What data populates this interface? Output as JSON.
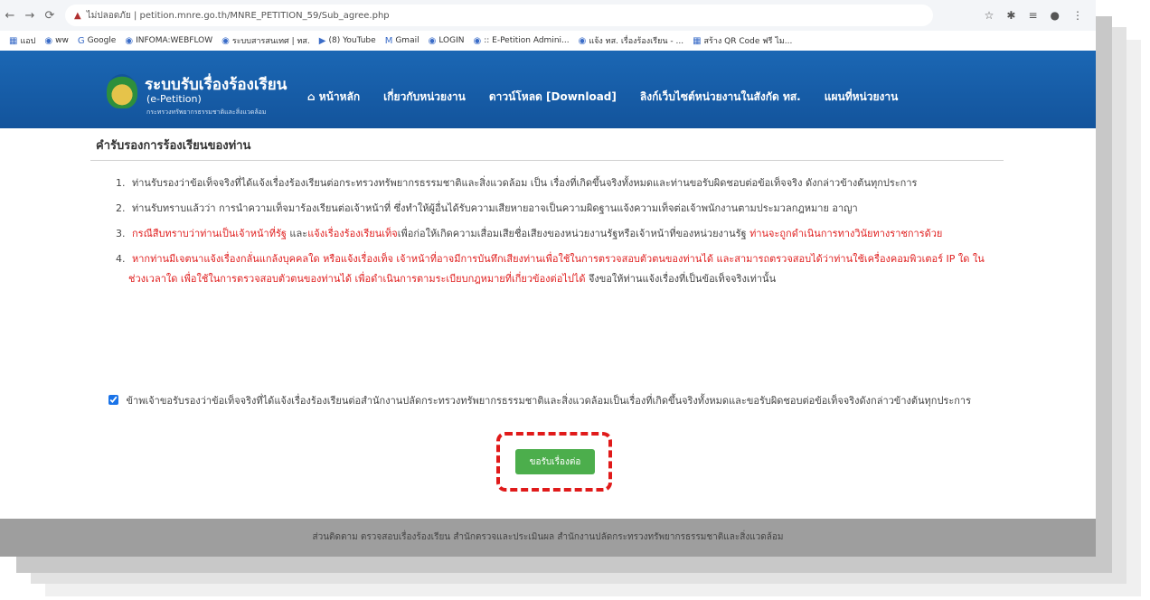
{
  "browser": {
    "security_label": "ไม่ปลอดภัย",
    "url": "petition.mnre.go.th/MNRE_PETITION_59/Sub_agree.php"
  },
  "bookmarks": [
    {
      "label": "แอป",
      "icon": "apps-icon"
    },
    {
      "label": "ww",
      "icon": "globe-icon"
    },
    {
      "label": "Google",
      "icon": "google-icon"
    },
    {
      "label": "INFOMA:WEBFLOW",
      "icon": "globe-icon"
    },
    {
      "label": "ระบบสารสนเทศ | ทส.",
      "icon": "globe-icon"
    },
    {
      "label": "(8) YouTube",
      "icon": "youtube-icon"
    },
    {
      "label": "Gmail",
      "icon": "gmail-icon"
    },
    {
      "label": "LOGIN",
      "icon": "globe-icon"
    },
    {
      "label": ":: E-Petition Admini...",
      "icon": "globe-icon"
    },
    {
      "label": "แจ้ง ทส. เรื่องร้องเรียน - ...",
      "icon": "globe-icon"
    },
    {
      "label": "สร้าง QR Code ฟรี ไม...",
      "icon": "qr-icon"
    }
  ],
  "site": {
    "title": "ระบบรับเรื่องร้องเรียน",
    "subtitle": "(e-Petition)",
    "org": "กระทรวงทรัพยากรธรรมชาติและสิ่งแวดล้อม"
  },
  "nav": [
    {
      "label": "หน้าหลัก",
      "icon": "home-icon"
    },
    {
      "label": "เกี่ยวกับหน่วยงาน"
    },
    {
      "label": "ดาวน์โหลด [Download]"
    },
    {
      "label": "ลิงก์เว็บไซต์หน่วยงานในสังกัด ทส."
    },
    {
      "label": "แผนที่หน่วยงาน"
    }
  ],
  "content": {
    "section_title": "คำรับรองการร้องเรียนของท่าน",
    "terms": [
      {
        "num": "1.",
        "parts": [
          {
            "text": "ท่านรับรองว่าข้อเท็จจริงที่ได้แจ้งเรื่องร้องเรียนต่อกระทรวงทรัพยากรธรรมชาติและสิ่งแวดล้อม เป็น เรื่องที่เกิดขึ้นจริงทั้งหมดและท่านขอรับผิดชอบต่อข้อเท็จจริง ดังกล่าวข้างต้นทุกประการ",
            "red": false
          }
        ]
      },
      {
        "num": "2.",
        "parts": [
          {
            "text": "ท่านรับทราบแล้วว่า การนำความเท็จมาร้องเรียนต่อเจ้าหน้าที่ ซึ่งทำให้ผู้อื่นได้รับความเสียหายอาจเป็นความผิดฐานแจ้งความเท็จต่อเจ้าพนักงานตามประมวลกฎหมาย อาญา",
            "red": false
          }
        ]
      },
      {
        "num": "3.",
        "parts": [
          {
            "text": "กรณีสืบทราบว่า",
            "red": true
          },
          {
            "text": "ท่านเป็นเจ้าหน้าที่รัฐ",
            "red": true
          },
          {
            "text": " และ",
            "red": false
          },
          {
            "text": "แจ้งเรื่องร้องเรียนเท็จ",
            "red": true
          },
          {
            "text": "เพื่อก่อให้เกิดความเสื่อมเสียชื่อเสียงของหน่วยงานรัฐหรือเจ้าหน้าที่ของหน่วยงานรัฐ ",
            "red": false
          },
          {
            "text": "ท่านจะถูกดำเนินการทางวินัยทางราชการด้วย",
            "red": true
          }
        ]
      },
      {
        "num": "4.",
        "parts": [
          {
            "text": "หากท่านมีเจตนาแจ้งเรื่องกลั่นแกล้งบุคคลใด หรือแจ้งเรื่องเท็จ เจ้าหน้าที่อาจมีการบันทึกเสียงท่านเพื่อใช้ในการตรวจสอบตัวตนของท่านได้ และสามารถตรวจสอบได้ว่าท่านใช้เครื่องคอมพิวเตอร์ IP ใด ในช่วงเวลาใด เพื่อใช้ในการตรวจสอบตัวตนของท่านได้ เพื่อดำเนินการตามระเบียบกฎหมายที่เกี่ยวข้องต่อไปได้",
            "red": true
          },
          {
            "text": " จึงขอให้ท่านแจ้งเรื่องที่เป็นข้อเท็จจริงเท่านั้น",
            "red": false
          }
        ]
      }
    ],
    "agree_text": "ข้าพเจ้าขอรับรองว่าข้อเท็จจริงที่ได้แจ้งเรื่องร้องเรียนต่อสำนักงานปลัดกระทรวงทรัพยากรธรรมชาติและสิ่งแวดล้อมเป็นเรื่องที่เกิดขึ้นจริงทั้งหมดและขอรับผิดชอบต่อข้อเท็จจริงดังกล่าวข้างต้นทุกประการ",
    "agree_checked": true,
    "confirm_label": "ขอรับเรื่องต่อ"
  },
  "footer": {
    "text": "ส่วนติดตาม ตรวจสอบเรื่องร้องเรียน สำนักตรวจและประเมินผล สำนักงานปลัดกระทรวงทรัพยากรธรรมชาติและสิ่งแวดล้อม"
  },
  "colors": {
    "header": "#1b67b4",
    "button": "#4cae4c",
    "highlight": "#e01a1a",
    "footer": "#9e9e9e"
  }
}
